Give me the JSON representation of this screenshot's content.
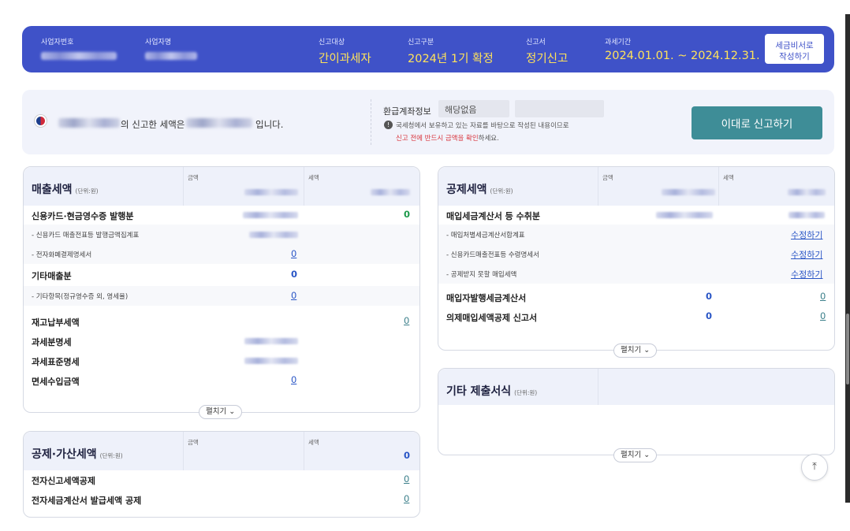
{
  "header": {
    "biz_no_label": "사업자번호",
    "biz_name_label": "사업자명",
    "target_label": "신고대상",
    "target_value": "간이과세자",
    "type_label": "신고구분",
    "type_value": "2024년 1기 확정",
    "form_label": "신고서",
    "form_value": "정기신고",
    "period_label": "과세기간",
    "period_value": "2024.01.01. ~ 2024.12.31.",
    "worksheet_button": "세금비서로 작성하기"
  },
  "summary": {
    "text_mid": "의 신고한 세액은",
    "text_end": "입니다.",
    "refund_label": "환급계좌정보",
    "refund_value": "해당없음",
    "info_icon": "info-icon",
    "note_line1": "국세청에서 보유하고 있는 자료를 바탕으로 작성된 내용이므로",
    "note_line2_red": "신고 전에 반드시 금액을 확인",
    "note_line2_end": "하세요.",
    "file_button": "이대로 신고하기"
  },
  "sales": {
    "title": "매출세액",
    "unit": "(단위:원)",
    "col_amount": "금액",
    "col_tax": "세액",
    "rows": {
      "card": "신용카드·현금영수증 발행분",
      "card_value": "0",
      "card_sub1": "- 신용카드 매출전표등 발행금액집계표",
      "card_sub2": "- 전자화폐결제명세서",
      "card_sub2_value": "0",
      "other": "기타매출분",
      "other_value": "0",
      "other_sub": "- 기타항목(정규영수증 외, 영세율)",
      "other_sub_value": "0",
      "inventory": "재고납부세액",
      "inventory_value": "0",
      "by_tax": "과세분명세",
      "by_std": "과세표준명세",
      "exempt": "면세수입금액",
      "exempt_value": "0"
    },
    "expand": "펼치기"
  },
  "deduct_add": {
    "title": "공제·가산세액",
    "unit": "(단위:원)",
    "col_amount": "금액",
    "col_tax": "세액",
    "head_value": "0",
    "rows": {
      "e_filing": "전자신고세액공제",
      "e_filing_value": "0",
      "e_invoice": "전자세금계산서 발급세액 공제",
      "e_invoice_value": "0"
    }
  },
  "deduction": {
    "title": "공제세액",
    "unit": "(단위:원)",
    "col_amount": "금액",
    "col_tax": "세액",
    "rows": {
      "purchase": "매입세금계산서 등 수취분",
      "sub1": "- 매입처별세금계산서합계표",
      "sub2": "- 신용카드매출전표등 수령명세서",
      "sub3": "- 공제받지 못할 매입세액",
      "edit_label": "수정하기",
      "buyer_invoice": "매입자발행세금계산서",
      "buyer_invoice_amount": "0",
      "buyer_invoice_tax": "0",
      "deemed": "의제매입세액공제 신고서",
      "deemed_amount": "0",
      "deemed_tax": "0"
    },
    "expand": "펼치기"
  },
  "other_forms": {
    "title": "기타 제출서식",
    "unit": "(단위:원)",
    "expand": "펼치기"
  },
  "scroll_top_icon": "arrow-up-icon"
}
